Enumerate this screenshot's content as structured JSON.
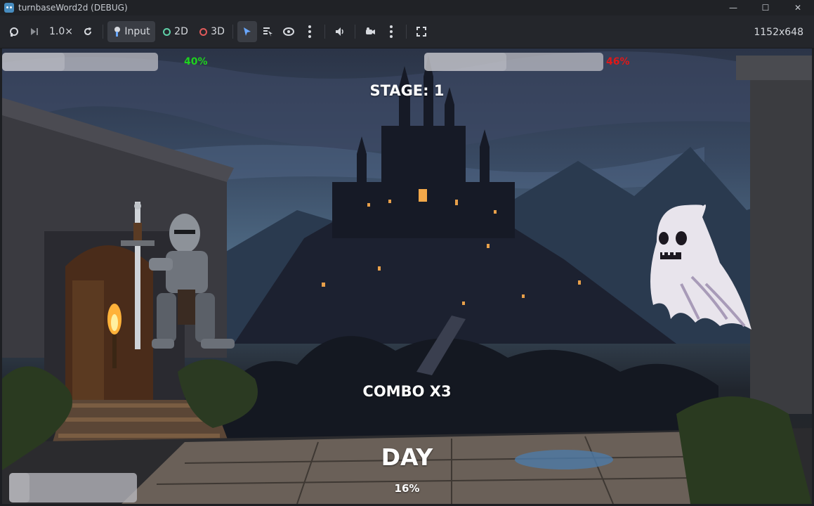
{
  "window": {
    "title": "turnbaseWord2d (DEBUG)",
    "controls": {
      "minimize": "—",
      "maximize": "☐",
      "close": "✕"
    }
  },
  "toolbar": {
    "speed": "1.0×",
    "input_label": "Input",
    "mode_2d": "2D",
    "mode_3d": "3D",
    "resolution": "1152x648",
    "color_2d": "#5fd0a8",
    "color_3d": "#e05a5a",
    "select_active_color": "#6aa8ff"
  },
  "hud": {
    "player_health_percent": "40%",
    "player_health_value": 0.4,
    "player_health_color": "#1ed21e",
    "enemy_health_percent": "46%",
    "enemy_health_value": 0.46,
    "enemy_health_color": "#e01818",
    "stage": "STAGE: 1",
    "combo": "COMBO X3",
    "phase": "DAY",
    "phase_percent": "16%",
    "phase_value": 0.16
  },
  "icons": [
    "godot-app-icon",
    "remote-debug-icon",
    "step-frame-icon",
    "reset-speed-icon",
    "input-icon",
    "select-icon",
    "list-icon",
    "camera-eye-icon",
    "kebab-menu-icon",
    "speaker-icon",
    "camera-icon",
    "fullscreen-icon"
  ]
}
